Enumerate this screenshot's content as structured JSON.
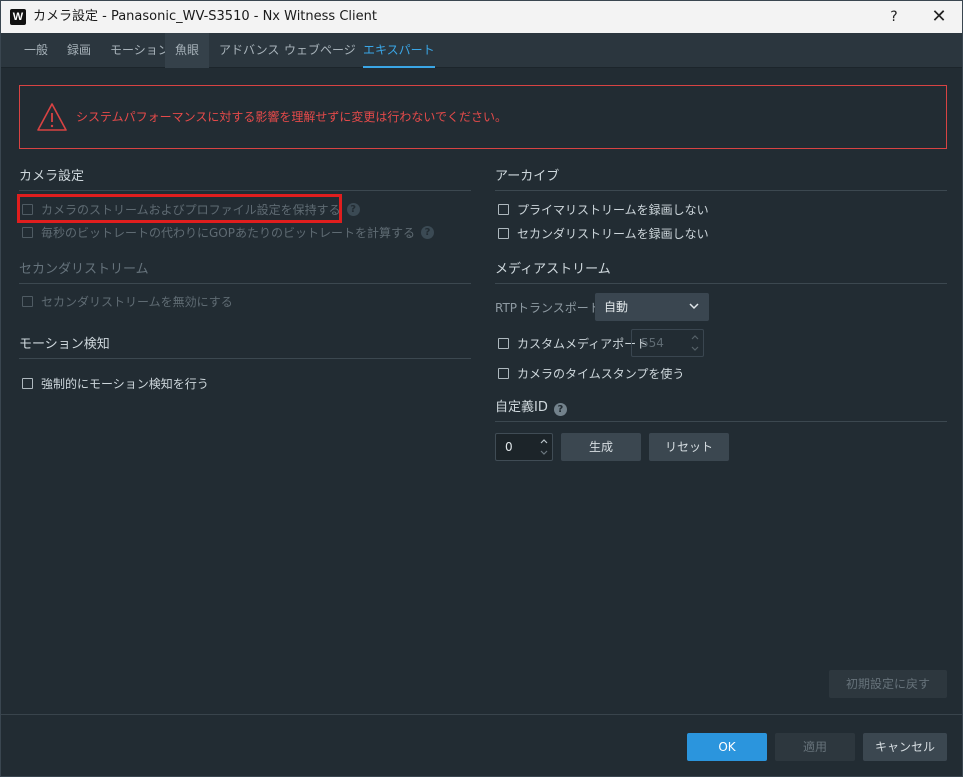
{
  "titlebar": {
    "app_icon": "W",
    "title": "カメラ設定 - Panasonic_WV-S3510 - Nx Witness Client",
    "help": "?",
    "close": "✕"
  },
  "tabs": [
    {
      "label": "一般"
    },
    {
      "label": "録画"
    },
    {
      "label": "モーション"
    },
    {
      "label": "魚眼"
    },
    {
      "label": "アドバンス"
    },
    {
      "label": "ウェブページ"
    },
    {
      "label": "エキスパート"
    }
  ],
  "warning": {
    "icon": "warning-triangle-icon",
    "text": "システムパフォーマンスに対する影響を理解せずに変更は行わないでください。",
    "color": "#d84343"
  },
  "camera_settings": {
    "title": "カメラ設定",
    "keep_stream_profile": "カメラのストリームおよびプロファイル設定を保持する",
    "bitrate_per_gop": "毎秒のビットレートの代わりにGOPあたりのビットレートを計算する",
    "help": "?"
  },
  "secondary_stream": {
    "title": "セカンダリストリーム",
    "disable_secondary": "セカンダリストリームを無効にする"
  },
  "motion_detection": {
    "title": "モーション検知",
    "force_motion": "強制的にモーション検知を行う"
  },
  "archive": {
    "title": "アーカイブ",
    "no_record_primary": "プライマリストリームを録画しない",
    "no_record_secondary": "セカンダリストリームを録画しない"
  },
  "media_streams": {
    "title": "メディアストリーム",
    "rtp_label": "RTPトランスポート",
    "rtp_value": "自動",
    "custom_port_label": "カスタムメディアポート",
    "custom_port_value": "554",
    "use_camera_timestamp": "カメラのタイムスタンプを使う"
  },
  "custom_id": {
    "title": "自定義ID",
    "help": "?",
    "value": "0",
    "generate": "生成",
    "reset": "リセット"
  },
  "restore_defaults": "初期設定に戻す",
  "footer": {
    "ok": "OK",
    "apply": "適用",
    "cancel": "キャンセル"
  },
  "colors": {
    "accent": "#2b95dd",
    "highlight": "#e01e1e",
    "background": "#222c33"
  }
}
